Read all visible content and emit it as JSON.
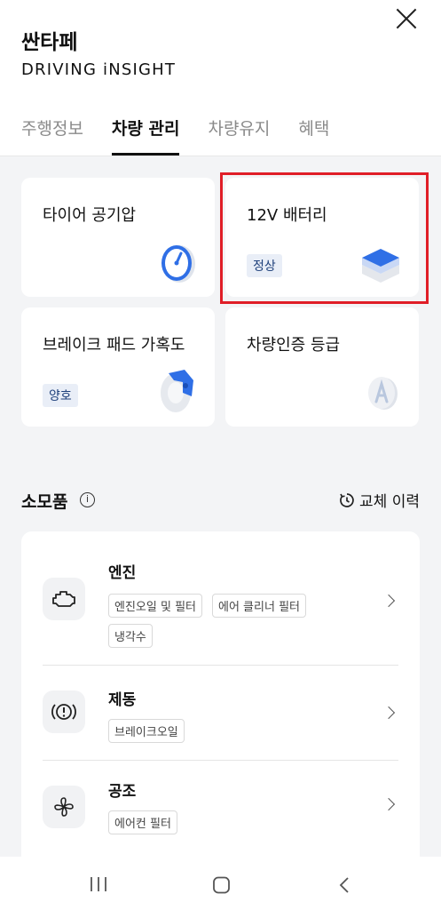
{
  "header": {
    "car_name": "싼타페",
    "brand": "DRIVING iNSIGHT",
    "tabs": [
      "주행정보",
      "차량 관리",
      "차량유지",
      "혜택"
    ]
  },
  "cards": [
    {
      "title": "타이어 공기압",
      "badge": ""
    },
    {
      "title": "12V 배터리",
      "badge": "정상"
    },
    {
      "title": "브레이크 패드 가혹도",
      "badge": "양호"
    },
    {
      "title": "차량인증 등급",
      "badge": ""
    }
  ],
  "consumables": {
    "title": "소모품",
    "history_label": "교체 이력",
    "items": [
      {
        "title": "엔진",
        "icon": "engine-icon",
        "chips": [
          "엔진오일 및 필터",
          "에어 클리너 필터",
          "냉각수"
        ]
      },
      {
        "title": "제동",
        "icon": "brake-warning-icon",
        "chips": [
          "브레이크오일"
        ]
      },
      {
        "title": "공조",
        "icon": "fan-icon",
        "chips": [
          "에어컨 필터"
        ]
      }
    ]
  },
  "colors": {
    "highlight": "#e01e27",
    "badge_bg": "#e9eef7",
    "accent_blue": "#2f6fe6"
  }
}
